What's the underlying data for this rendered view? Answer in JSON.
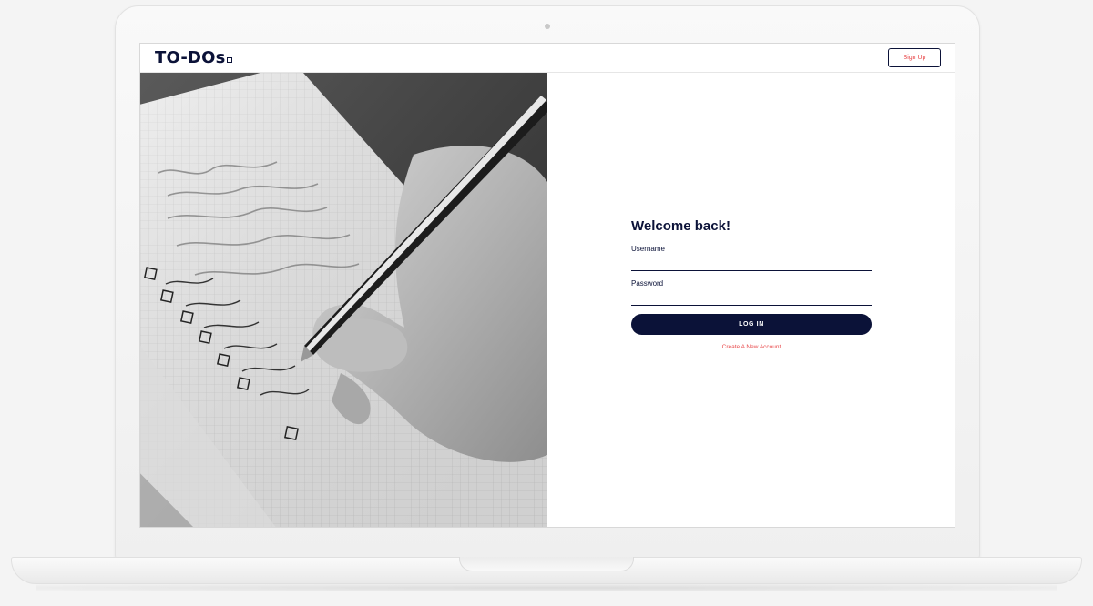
{
  "header": {
    "logo_text": "TO-DOs",
    "signup_label": "Sign Up"
  },
  "photo": {
    "description_icon": "notebook-checklist-photo"
  },
  "login": {
    "title": "Welcome back!",
    "username_label": "Username",
    "username_value": "",
    "password_label": "Password",
    "password_value": "",
    "submit_label": "LOG IN",
    "create_account_label": "Create A New Account"
  },
  "colors": {
    "navy": "#0b1238",
    "accent_red": "#e8484a",
    "white": "#ffffff"
  }
}
